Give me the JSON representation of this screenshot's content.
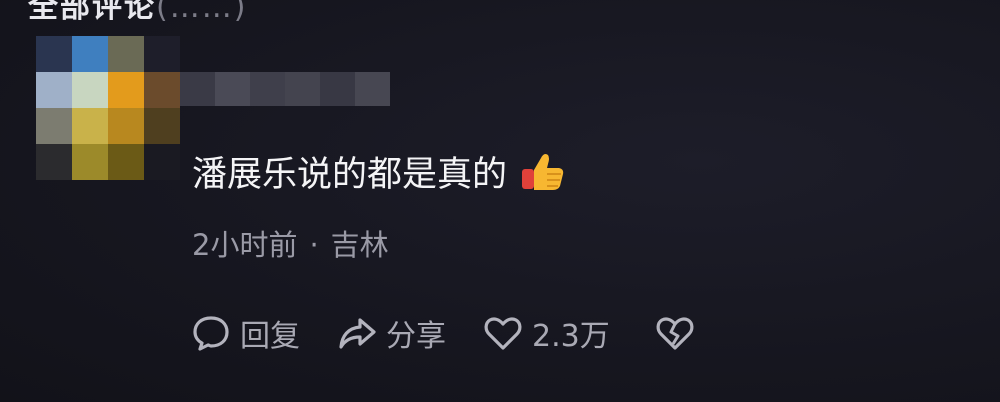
{
  "header_cut": {
    "text": "全部评论",
    "count_text": "(……)"
  },
  "comment": {
    "text": "潘展乐说的都是真的",
    "emoji": "thumbs-up-icon",
    "time": "2小时前",
    "separator": "·",
    "location": "吉林"
  },
  "actions": {
    "reply_label": "回复",
    "share_label": "分享",
    "like_count": "2.3万"
  },
  "colors": {
    "background": "#15151f",
    "text_primary": "#f4f4f6",
    "text_secondary": "#9a9aa6"
  }
}
